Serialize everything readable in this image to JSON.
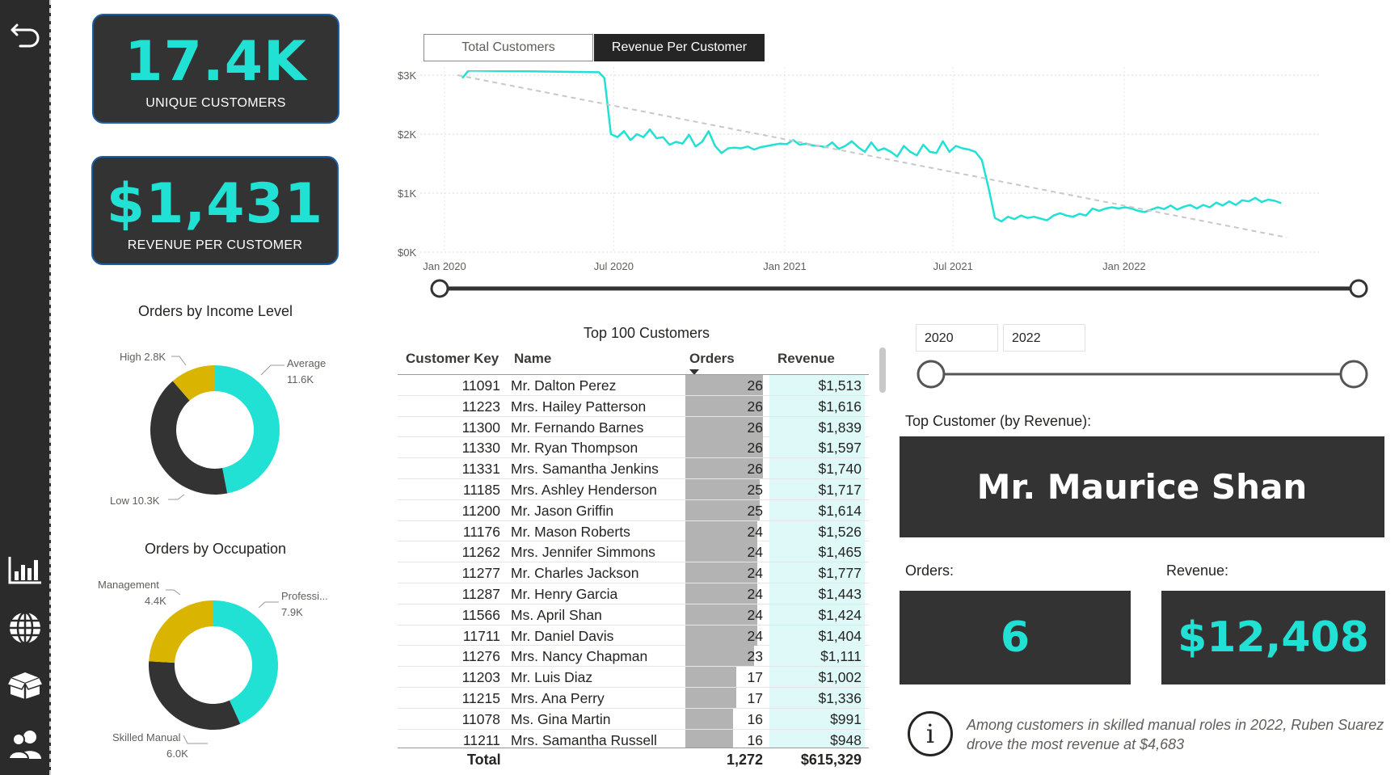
{
  "nav": {
    "items": [
      {
        "icon": "back-arrow-icon"
      },
      {
        "icon": "bar-chart-icon"
      },
      {
        "icon": "globe-icon"
      },
      {
        "icon": "box-icon"
      },
      {
        "icon": "users-icon"
      }
    ]
  },
  "kpis": {
    "unique_customers": {
      "value": "17.4K",
      "label": "UNIQUE CUSTOMERS"
    },
    "revenue_per_customer": {
      "value": "$1,431",
      "label": "REVENUE PER CUSTOMER"
    }
  },
  "income_donut": {
    "title": "Orders by Income Level",
    "slices": [
      {
        "label": "Average",
        "value_text": "11.6K",
        "value": 11600,
        "color": "#21e1d5"
      },
      {
        "label": "Low",
        "value_text": "10.3K",
        "value": 10300,
        "color": "#333333"
      },
      {
        "label": "High",
        "value_text": "2.8K",
        "value": 2800,
        "color": "#d9b400"
      }
    ],
    "labels": {
      "high": "High 2.8K",
      "average": "Average",
      "average_value": "11.6K",
      "low": "Low 10.3K"
    }
  },
  "occupation_donut": {
    "title": "Orders by Occupation",
    "slices": [
      {
        "label": "Professi...",
        "value_text": "7.9K",
        "value": 7900,
        "color": "#21e1d5"
      },
      {
        "label": "Skilled Manual",
        "value_text": "6.0K",
        "value": 6000,
        "color": "#333333"
      },
      {
        "label": "Management",
        "value_text": "4.4K",
        "value": 4400,
        "color": "#d9b400"
      }
    ],
    "labels": {
      "management": "Management",
      "management_value": "4.4K",
      "professional": "Professi...",
      "professional_value": "7.9K",
      "skilled": "Skilled Manual",
      "skilled_value": "6.0K"
    }
  },
  "line_tabs": {
    "total_customers": "Total Customers",
    "revenue_per_customer": "Revenue Per Customer"
  },
  "chart_data": {
    "type": "line",
    "title": "",
    "xlabel": "",
    "ylabel": "",
    "y_ticks": [
      "$0K",
      "$1K",
      "$2K",
      "$3K"
    ],
    "x_ticks": [
      "Jan 2020",
      "Jul 2020",
      "Jan 2021",
      "Jul 2021",
      "Jan 2022"
    ],
    "ylim": [
      0,
      3000
    ],
    "x_range": [
      "2020-01-01",
      "2022-06-30"
    ],
    "grid": true,
    "series": [
      {
        "color": "#21e1d5",
        "style": "solid",
        "points": [
          [
            "2020-01-20",
            2950
          ],
          [
            "2020-01-27",
            3080
          ],
          [
            "2020-06-15",
            3050
          ],
          [
            "2020-06-21",
            2950
          ],
          [
            "2020-06-28",
            2000
          ],
          [
            "2020-07-05",
            1950
          ],
          [
            "2020-07-12",
            2050
          ],
          [
            "2020-07-19",
            1900
          ],
          [
            "2020-07-26",
            2000
          ],
          [
            "2020-08-02",
            1950
          ],
          [
            "2020-08-09",
            2080
          ],
          [
            "2020-08-16",
            1930
          ],
          [
            "2020-08-23",
            1950
          ],
          [
            "2020-08-30",
            1820
          ],
          [
            "2020-09-06",
            1870
          ],
          [
            "2020-09-13",
            1840
          ],
          [
            "2020-09-20",
            1990
          ],
          [
            "2020-09-27",
            1790
          ],
          [
            "2020-10-04",
            1870
          ],
          [
            "2020-10-11",
            2050
          ],
          [
            "2020-10-18",
            1800
          ],
          [
            "2020-10-25",
            1680
          ],
          [
            "2020-11-01",
            1760
          ],
          [
            "2020-11-08",
            1770
          ],
          [
            "2020-11-15",
            1760
          ],
          [
            "2020-11-22",
            1790
          ],
          [
            "2020-11-29",
            1740
          ],
          [
            "2020-12-06",
            1780
          ],
          [
            "2020-12-13",
            1800
          ],
          [
            "2020-12-20",
            1820
          ],
          [
            "2020-12-27",
            1840
          ],
          [
            "2021-01-03",
            1830
          ],
          [
            "2021-01-10",
            1900
          ],
          [
            "2021-01-17",
            1820
          ],
          [
            "2021-01-24",
            1840
          ],
          [
            "2021-01-31",
            1810
          ],
          [
            "2021-02-07",
            1800
          ],
          [
            "2021-02-14",
            1780
          ],
          [
            "2021-02-21",
            1860
          ],
          [
            "2021-02-28",
            1750
          ],
          [
            "2021-03-07",
            1800
          ],
          [
            "2021-03-14",
            1880
          ],
          [
            "2021-03-21",
            1780
          ],
          [
            "2021-03-28",
            1700
          ],
          [
            "2021-04-04",
            1860
          ],
          [
            "2021-04-11",
            1720
          ],
          [
            "2021-04-18",
            1760
          ],
          [
            "2021-04-25",
            1700
          ],
          [
            "2021-05-02",
            1620
          ],
          [
            "2021-05-09",
            1800
          ],
          [
            "2021-05-16",
            1700
          ],
          [
            "2021-05-23",
            1640
          ],
          [
            "2021-05-30",
            1820
          ],
          [
            "2021-06-06",
            1700
          ],
          [
            "2021-06-13",
            1680
          ],
          [
            "2021-06-20",
            1880
          ],
          [
            "2021-06-27",
            1700
          ],
          [
            "2021-07-04",
            1800
          ],
          [
            "2021-07-11",
            1760
          ],
          [
            "2021-07-18",
            1740
          ],
          [
            "2021-07-25",
            1700
          ],
          [
            "2021-08-01",
            1560
          ],
          [
            "2021-08-08",
            1100
          ],
          [
            "2021-08-15",
            580
          ],
          [
            "2021-08-22",
            520
          ],
          [
            "2021-08-29",
            600
          ],
          [
            "2021-09-05",
            560
          ],
          [
            "2021-09-12",
            620
          ],
          [
            "2021-09-19",
            580
          ],
          [
            "2021-09-26",
            600
          ],
          [
            "2021-10-03",
            570
          ],
          [
            "2021-10-10",
            540
          ],
          [
            "2021-10-17",
            620
          ],
          [
            "2021-10-24",
            660
          ],
          [
            "2021-10-31",
            620
          ],
          [
            "2021-11-07",
            600
          ],
          [
            "2021-11-14",
            650
          ],
          [
            "2021-11-21",
            620
          ],
          [
            "2021-11-28",
            740
          ],
          [
            "2021-12-05",
            700
          ],
          [
            "2021-12-12",
            740
          ],
          [
            "2021-12-19",
            760
          ],
          [
            "2021-12-26",
            740
          ],
          [
            "2022-01-02",
            760
          ],
          [
            "2022-01-09",
            740
          ],
          [
            "2022-01-16",
            700
          ],
          [
            "2022-01-23",
            680
          ],
          [
            "2022-01-30",
            720
          ],
          [
            "2022-02-06",
            760
          ],
          [
            "2022-02-13",
            730
          ],
          [
            "2022-02-20",
            790
          ],
          [
            "2022-02-27",
            720
          ],
          [
            "2022-03-06",
            770
          ],
          [
            "2022-03-13",
            800
          ],
          [
            "2022-03-20",
            740
          ],
          [
            "2022-03-27",
            800
          ],
          [
            "2022-04-03",
            760
          ],
          [
            "2022-04-10",
            840
          ],
          [
            "2022-04-17",
            790
          ],
          [
            "2022-04-24",
            860
          ],
          [
            "2022-05-01",
            800
          ],
          [
            "2022-05-08",
            880
          ],
          [
            "2022-05-15",
            860
          ],
          [
            "2022-05-22",
            920
          ],
          [
            "2022-05-29",
            850
          ],
          [
            "2022-06-05",
            890
          ],
          [
            "2022-06-12",
            870
          ],
          [
            "2022-06-19",
            830
          ]
        ]
      },
      {
        "color": "#c8c8c8",
        "style": "dashed",
        "points": [
          [
            "2020-01-15",
            3000
          ],
          [
            "2022-06-25",
            250
          ]
        ]
      }
    ]
  },
  "table": {
    "title": "Top 100 Customers",
    "headers": {
      "key": "Customer Key",
      "name": "Name",
      "orders": "Orders",
      "revenue": "Revenue"
    },
    "rows": [
      {
        "key": "11091",
        "name": "Mr. Dalton Perez",
        "orders": "26",
        "revenue": "$1,513"
      },
      {
        "key": "11223",
        "name": "Mrs. Hailey Patterson",
        "orders": "26",
        "revenue": "$1,616"
      },
      {
        "key": "11300",
        "name": "Mr. Fernando Barnes",
        "orders": "26",
        "revenue": "$1,839"
      },
      {
        "key": "11330",
        "name": "Mr. Ryan Thompson",
        "orders": "26",
        "revenue": "$1,597"
      },
      {
        "key": "11331",
        "name": "Mrs. Samantha Jenkins",
        "orders": "26",
        "revenue": "$1,740"
      },
      {
        "key": "11185",
        "name": "Mrs. Ashley Henderson",
        "orders": "25",
        "revenue": "$1,717"
      },
      {
        "key": "11200",
        "name": "Mr. Jason Griffin",
        "orders": "25",
        "revenue": "$1,614"
      },
      {
        "key": "11176",
        "name": "Mr. Mason Roberts",
        "orders": "24",
        "revenue": "$1,526"
      },
      {
        "key": "11262",
        "name": "Mrs. Jennifer Simmons",
        "orders": "24",
        "revenue": "$1,465"
      },
      {
        "key": "11277",
        "name": "Mr. Charles Jackson",
        "orders": "24",
        "revenue": "$1,777"
      },
      {
        "key": "11287",
        "name": "Mr. Henry Garcia",
        "orders": "24",
        "revenue": "$1,443"
      },
      {
        "key": "11566",
        "name": "Ms. April Shan",
        "orders": "24",
        "revenue": "$1,424"
      },
      {
        "key": "11711",
        "name": "Mr. Daniel Davis",
        "orders": "24",
        "revenue": "$1,404"
      },
      {
        "key": "11276",
        "name": "Mrs. Nancy Chapman",
        "orders": "23",
        "revenue": "$1,111"
      },
      {
        "key": "11203",
        "name": "Mr. Luis Diaz",
        "orders": "17",
        "revenue": "$1,002"
      },
      {
        "key": "11215",
        "name": "Mrs. Ana Perry",
        "orders": "17",
        "revenue": "$1,336"
      },
      {
        "key": "11078",
        "name": "Ms. Gina Martin",
        "orders": "16",
        "revenue": "$991"
      },
      {
        "key": "11211",
        "name": "Mrs. Samantha Russell",
        "orders": "16",
        "revenue": "$948"
      }
    ],
    "total": {
      "label": "Total",
      "orders": "1,272",
      "revenue": "$615,329"
    }
  },
  "year_filter": {
    "from": "2020",
    "to": "2022"
  },
  "top_customer": {
    "label": "Top Customer (by Revenue):",
    "name": "Mr. Maurice Shan",
    "orders_label": "Orders:",
    "orders": "6",
    "revenue_label": "Revenue:",
    "revenue": "$12,408"
  },
  "insight": {
    "line1": "Among customers in skilled manual roles in 2022, Ruben Suarez",
    "line2": "drove the most revenue at $4,683"
  },
  "colors": {
    "accent": "#21e1d5",
    "dark": "#333333",
    "gold": "#d9b400"
  }
}
